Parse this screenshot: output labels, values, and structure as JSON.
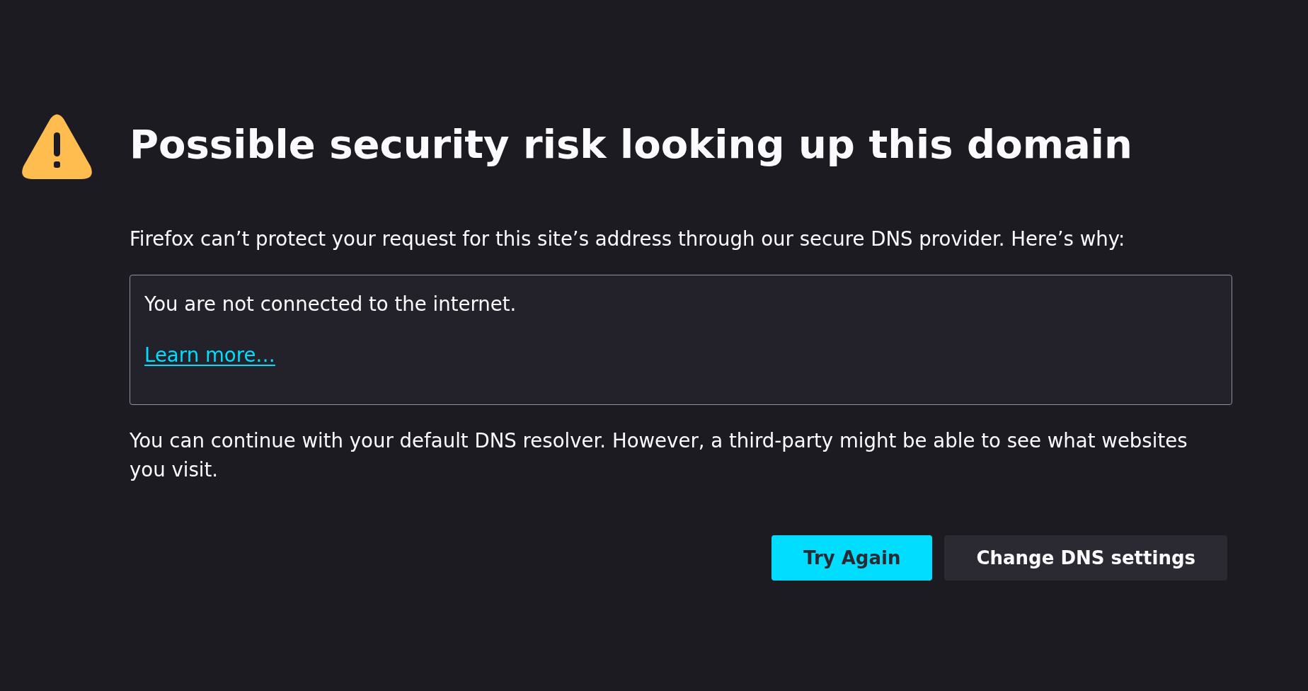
{
  "title": "Possible security risk looking up this domain",
  "intro": "Firefox can’t protect your request for this site’s address through our secure DNS provider. Here’s why:",
  "details": {
    "message": "You are not connected to the internet.",
    "link": "Learn more…"
  },
  "note": "You can continue with your default DNS resolver. However, a third-party might be able to see what websites you visit.",
  "buttons": [
    {
      "label": "Try Again",
      "kind": "primary"
    },
    {
      "label": "Change DNS settings",
      "kind": "secondary"
    }
  ]
}
